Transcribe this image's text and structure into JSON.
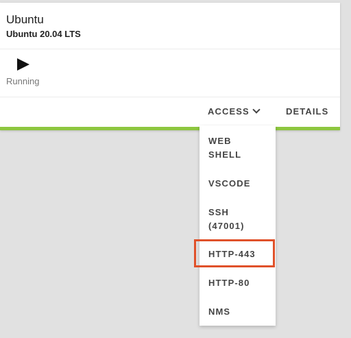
{
  "card": {
    "title": "Ubuntu",
    "subtitle": "Ubuntu 20.04 LTS",
    "status_icon": "play-icon",
    "status": "Running",
    "accent_color": "#8dc63f"
  },
  "actions": {
    "access_label": "ACCESS",
    "access_icon": "chevron-down-icon",
    "details_label": "DETAILS"
  },
  "dropdown": {
    "items": [
      {
        "line1": "WEB",
        "line2": "SHELL"
      },
      {
        "line1": "VSCODE"
      },
      {
        "line1": "SSH",
        "line2": "(47001)"
      },
      {
        "line1": "HTTP-443",
        "highlighted": true
      },
      {
        "line1": "HTTP-80"
      },
      {
        "line1": "NMS"
      }
    ],
    "highlight_color": "#e0512a"
  }
}
